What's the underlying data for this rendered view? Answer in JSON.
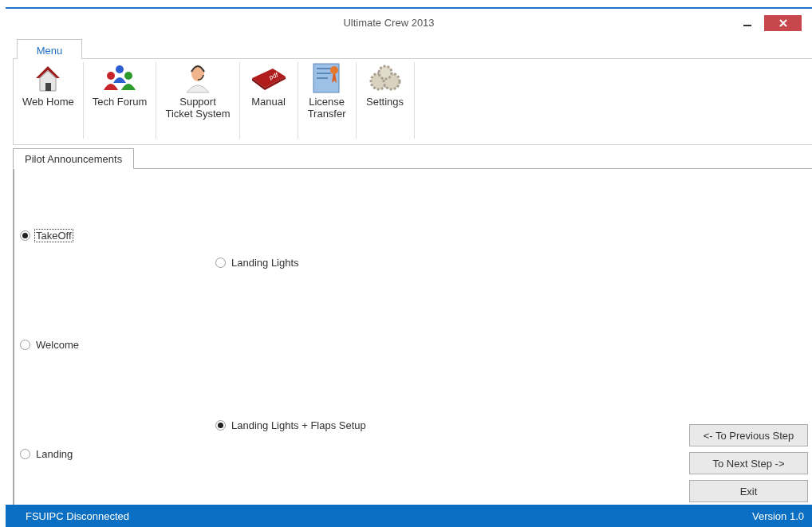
{
  "window": {
    "title": "Ultimate Crew 2013"
  },
  "ribbon_tabs": [
    {
      "label": "Menu",
      "selected": true
    }
  ],
  "ribbon_items": [
    {
      "kind": "house",
      "lines": [
        "Web Home"
      ]
    },
    {
      "kind": "people",
      "lines": [
        "Tech Forum"
      ]
    },
    {
      "kind": "agent",
      "lines": [
        "Support",
        "Ticket System"
      ]
    },
    {
      "kind": "pdf",
      "lines": [
        "Manual"
      ]
    },
    {
      "kind": "certificate",
      "lines": [
        "License",
        "Transfer"
      ]
    },
    {
      "kind": "gears",
      "lines": [
        "Settings"
      ]
    }
  ],
  "page_tabs": [
    {
      "label": "Pilot Announcements",
      "selected": true
    }
  ],
  "announcements": [
    {
      "kind": "phase",
      "label": "TakeOff",
      "selected": true,
      "focused": true
    },
    {
      "kind": "procedure",
      "label": "Landing Lights",
      "selected": false,
      "focused": false
    },
    {
      "kind": "phase",
      "label": "Welcome",
      "selected": false,
      "focused": false
    },
    {
      "kind": "procedure",
      "label": "Landing Lights + Flaps Setup",
      "selected": true,
      "focused": false
    },
    {
      "kind": "phase",
      "label": "Landing",
      "selected": false,
      "focused": false
    }
  ],
  "buttons": [
    "<- To Previous Step",
    "To Next Step ->",
    "Exit"
  ],
  "status_bar": {
    "connection": "FSUIPC Disconnected",
    "version": "Version 1.0"
  }
}
